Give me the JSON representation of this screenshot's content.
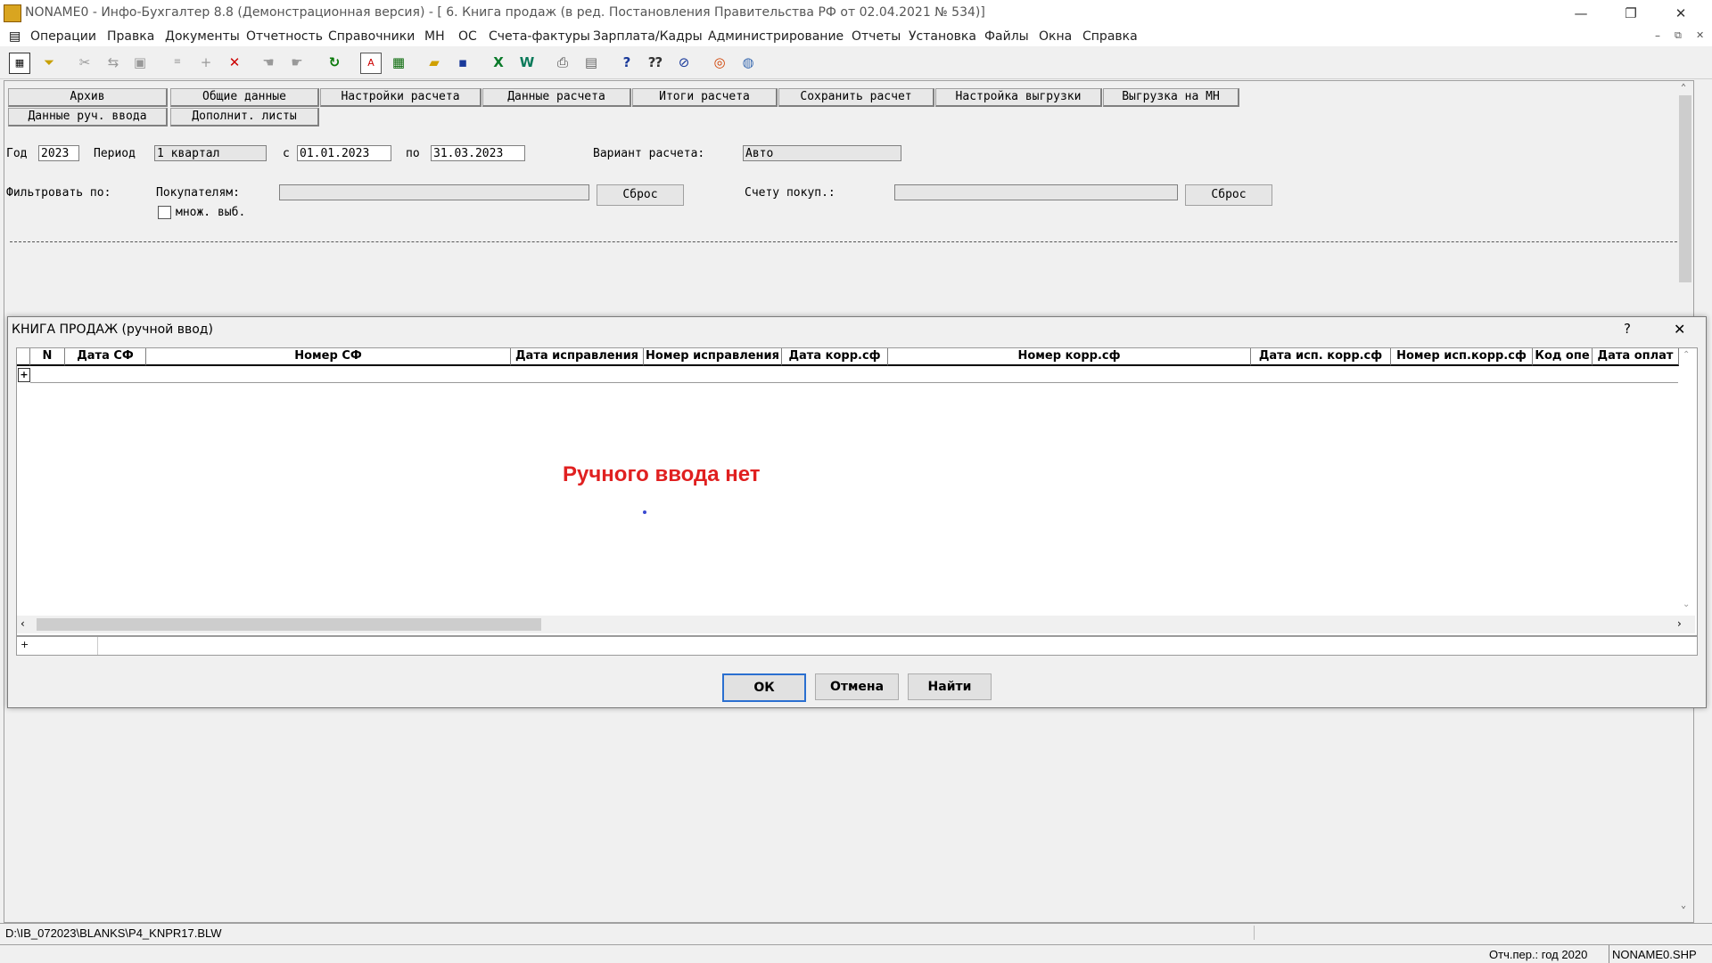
{
  "window": {
    "title": "NONAME0 - Инфо-Бухгалтер 8.8 (Демонстрационная версия) - [  6. Книга продаж (в ред. Постановления Правительства РФ от 02.04.2021 № 534)]",
    "minimize_glyph": "—",
    "restore_glyph": "❐",
    "close_glyph": "✕",
    "mdi_minimize_glyph": "–",
    "mdi_restore_glyph": "⧉",
    "mdi_close_glyph": "✕"
  },
  "menu": [
    "Операции",
    "Правка",
    "Документы",
    "Отчетность",
    "Справочники",
    "МН",
    "ОС",
    "Счета-фактуры",
    "Зарплата/Кадры",
    "Администрирование",
    "Отчеты",
    "Установка",
    "Файлы",
    "Окна",
    "Справка"
  ],
  "toolbar_icons": [
    "calculator-grid-icon",
    "filter-icon",
    "cut-icon",
    "move-icon",
    "paste-icon",
    "calc-icon",
    "add-icon",
    "delete-icon",
    "hand-icon",
    "hand-stop-icon",
    "refresh-icon",
    "pdf-icon",
    "spreadsheet-icon",
    "open-folder-icon",
    "save-icon",
    "excel-icon",
    "word-icon",
    "print-icon",
    "preview-icon",
    "help-icon",
    "context-help-icon",
    "compass-icon",
    "support-icon",
    "globe-icon"
  ],
  "tabs_row1": [
    "Архив",
    "Общие данные",
    "Настройки расчета",
    "Данные расчета",
    "Итоги расчета",
    "Сохранить расчет",
    "Настройка выгрузки",
    "Выгрузка на МН"
  ],
  "tabs_row2": [
    "Данные руч. ввода",
    "Дополнит. листы"
  ],
  "form": {
    "year_label": "Год",
    "year_value": "2023",
    "period_label": "Период",
    "period_value": "1 квартал",
    "from_label": "с",
    "from_value": "01.01.2023",
    "to_label": "по",
    "to_value": "31.03.2023",
    "variant_label": "Вариант расчета:",
    "variant_value": "Авто",
    "filter_label": "Фильтровать по:",
    "buyers_label": "Покупателям:",
    "buyers_value": "",
    "reset1": "Сброс",
    "account_label": "Счету покуп.:",
    "account_value": "",
    "reset2": "Сброс",
    "multi_label": "множ. выб."
  },
  "dialog": {
    "title": "КНИГА ПРОДАЖ (ручной ввод)",
    "help": "?",
    "close": "✕",
    "columns": [
      "N",
      "Дата СФ",
      "Номер СФ",
      "Дата исправления",
      "Номер исправления",
      "Дата корр.сф",
      "Номер корр.сф",
      "Дата исп. корр.сф",
      "Номер исп.корр.сф",
      "Код опе",
      "Дата оплат"
    ],
    "add_row": "+",
    "empty_message": "Ручного ввода нет",
    "empty_color": "#e02020",
    "footer_plus": "+",
    "ok": "ОК",
    "cancel": "Отмена",
    "find": "Найти"
  },
  "status": {
    "path": "D:\\IB_072023\\BLANKS\\P4_KNPR17.BLW",
    "period": "Отч.пер.: год 2020",
    "file": "NONAME0.SHP"
  }
}
